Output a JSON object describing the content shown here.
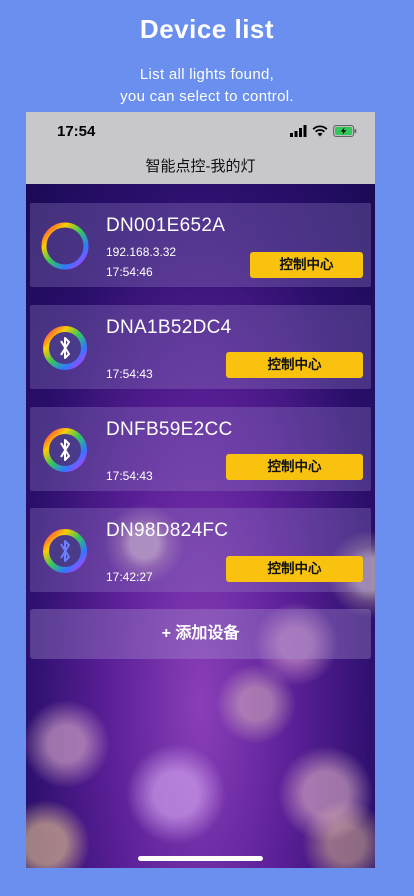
{
  "hero": {
    "title": "Device list",
    "subtitle_line1": "List all lights found,",
    "subtitle_line2": "you can select to control."
  },
  "status_bar": {
    "time": "17:54",
    "icons": [
      "signal-icon",
      "wifi-icon",
      "battery-charging-icon"
    ]
  },
  "nav": {
    "title": "智能点控-我的灯"
  },
  "devices": [
    {
      "name": "DN001E652A",
      "ip": "192.168.3.32",
      "time": "17:54:46",
      "button": "控制中心",
      "icon": "color-ring-icon"
    },
    {
      "name": "DNA1B52DC4",
      "ip": "",
      "time": "17:54:43",
      "button": "控制中心",
      "icon": "bluetooth-color-ring-icon"
    },
    {
      "name": "DNFB59E2CC",
      "ip": "",
      "time": "17:54:43",
      "button": "控制中心",
      "icon": "bluetooth-color-ring-icon"
    },
    {
      "name": "DN98D824FC",
      "ip": "",
      "time": "17:42:27",
      "button": "控制中心",
      "icon": "bluetooth-color-ring-icon"
    }
  ],
  "add_device": {
    "label": "+ 添加设备"
  },
  "colors": {
    "page_bg": "#6b8fef",
    "button_yellow": "#f9c20e",
    "bar_gray": "#c8c8cc"
  }
}
